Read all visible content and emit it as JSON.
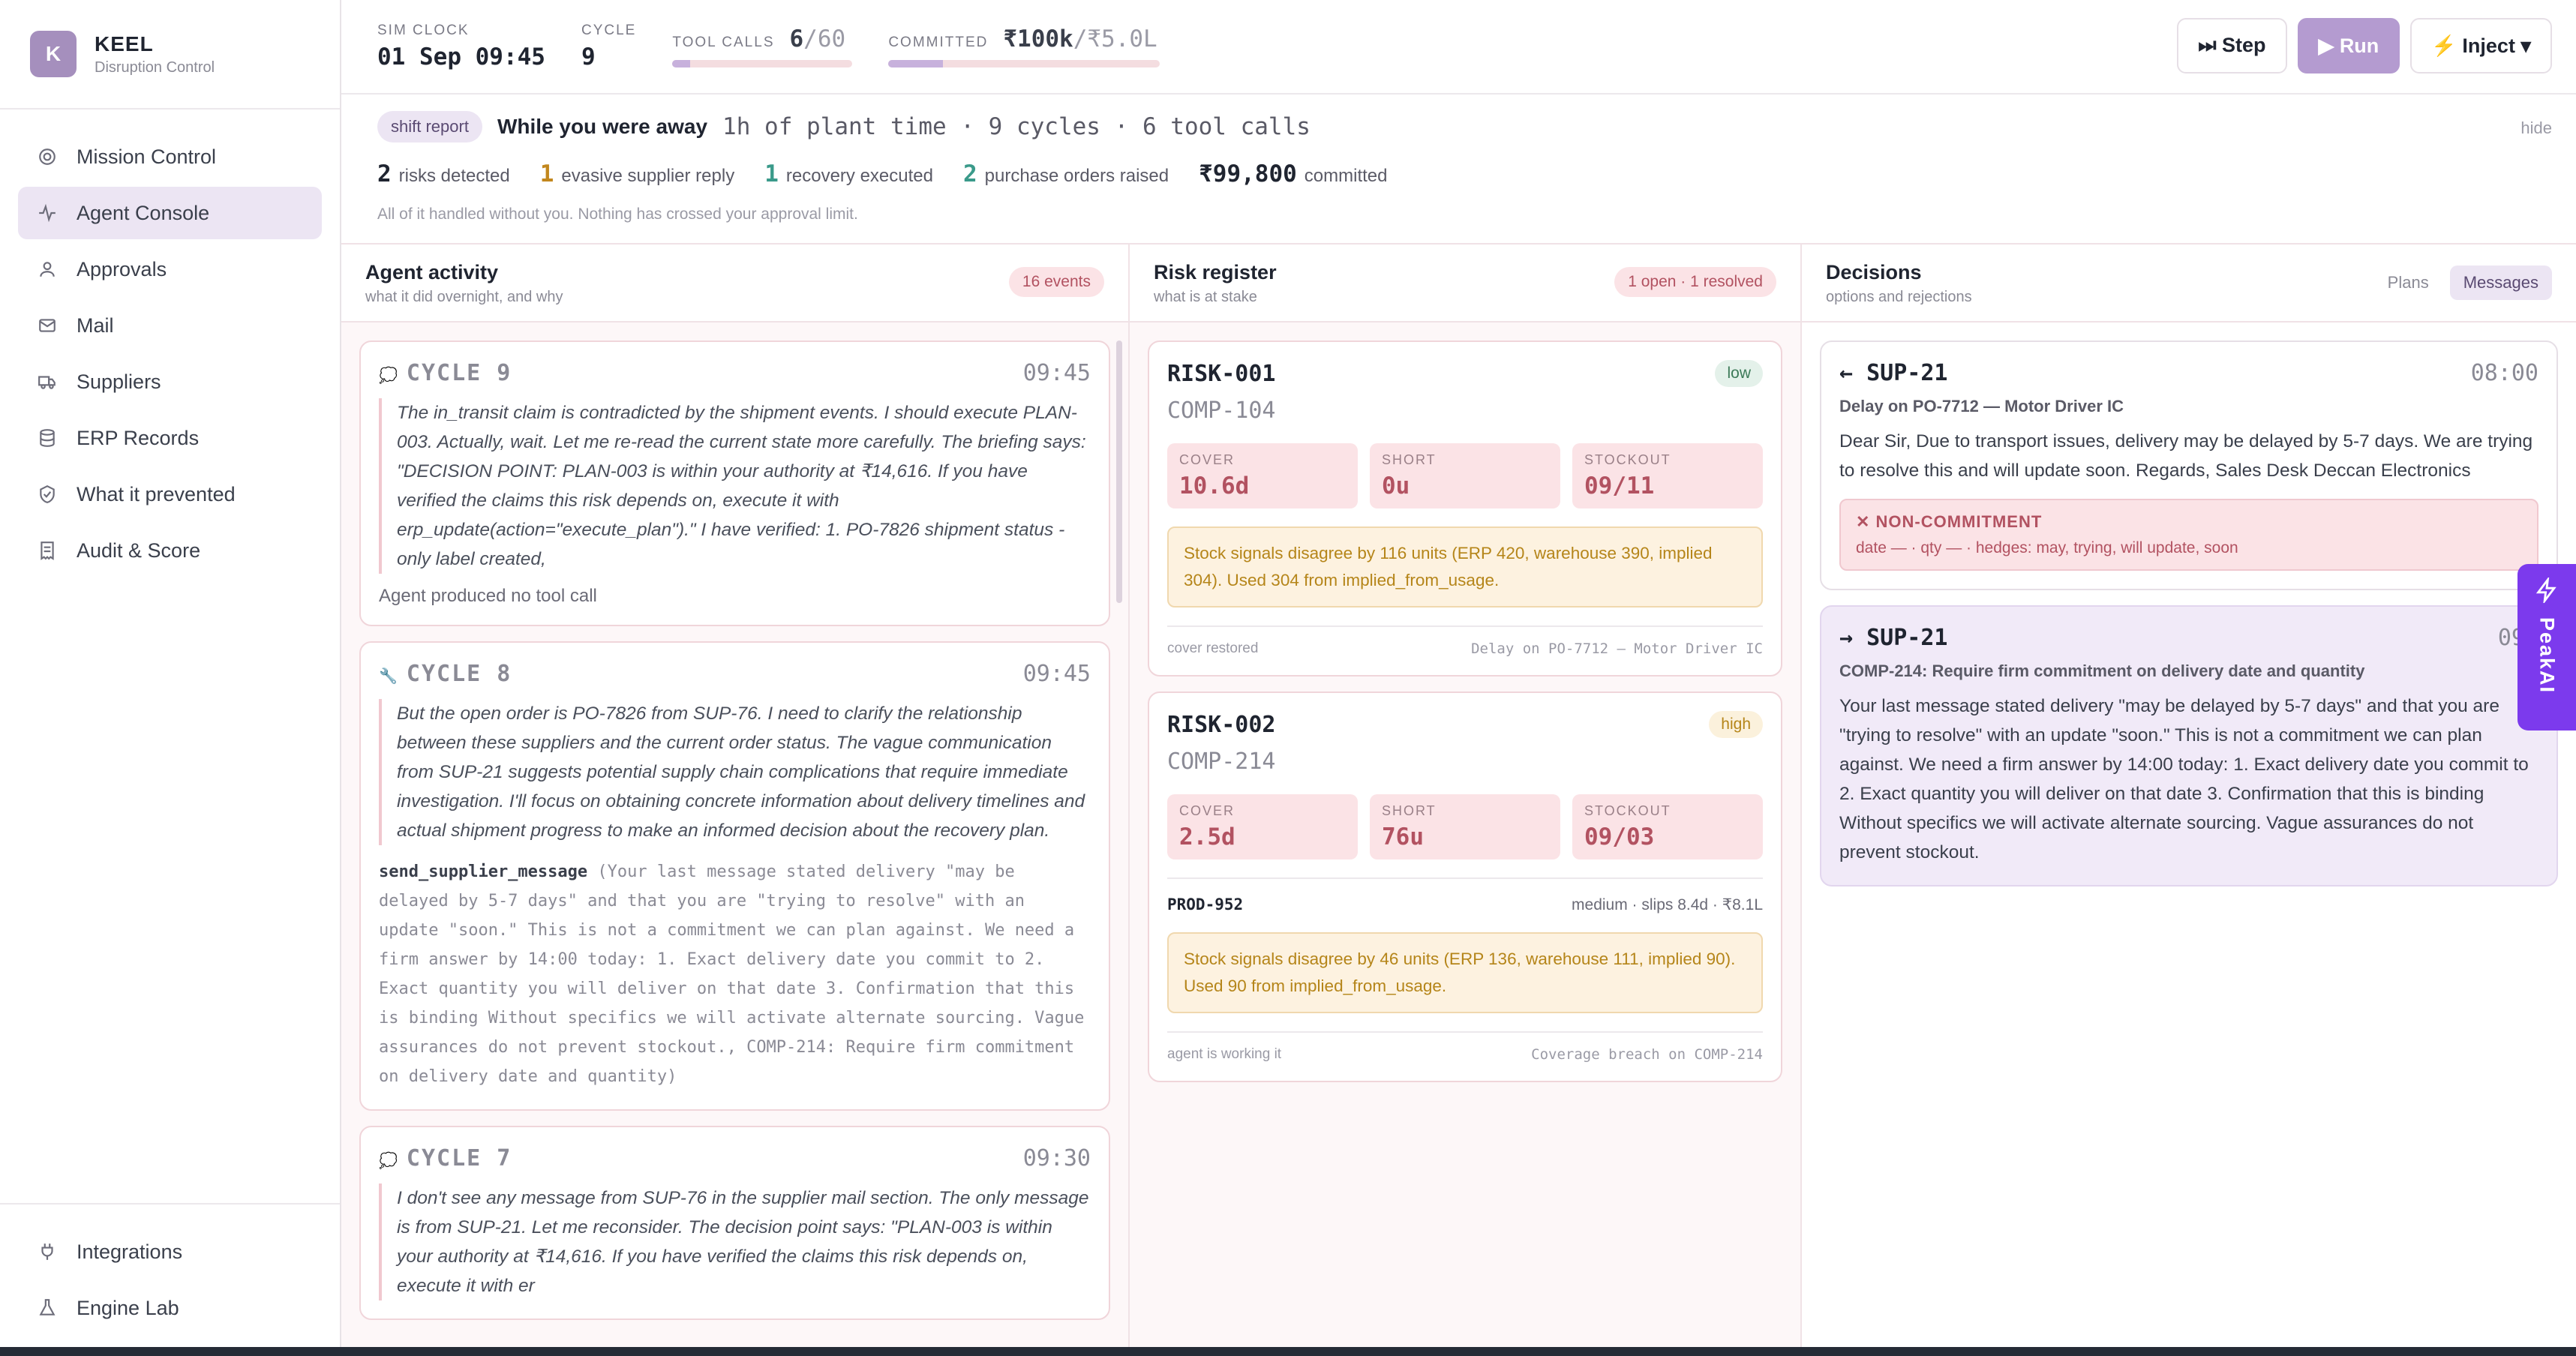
{
  "brand": {
    "initial": "K",
    "name": "KEEL",
    "subtitle": "Disruption Control"
  },
  "nav": {
    "items": [
      {
        "label": "Mission Control",
        "icon": "target-icon"
      },
      {
        "label": "Agent Console",
        "icon": "activity-icon",
        "active": true
      },
      {
        "label": "Approvals",
        "icon": "user-check-icon"
      },
      {
        "label": "Mail",
        "icon": "mail-icon"
      },
      {
        "label": "Suppliers",
        "icon": "truck-icon"
      },
      {
        "label": "ERP Records",
        "icon": "database-icon"
      },
      {
        "label": "What it prevented",
        "icon": "shield-icon"
      },
      {
        "label": "Audit & Score",
        "icon": "receipt-icon"
      }
    ],
    "bottom": [
      {
        "label": "Integrations",
        "icon": "plug-icon"
      },
      {
        "label": "Engine Lab",
        "icon": "flask-icon"
      }
    ]
  },
  "topbar": {
    "sim_clock_label": "SIM CLOCK",
    "sim_clock_value": "01 Sep 09:45",
    "cycle_label": "CYCLE",
    "cycle_value": "9",
    "tool_calls_label": "TOOL CALLS",
    "tool_calls_used": "6",
    "tool_calls_limit": "/60",
    "tool_calls_fraction": 0.1,
    "committed_label": "COMMITTED",
    "committed_value": "₹100k",
    "committed_limit": "/₹5.0L",
    "committed_fraction": 0.2,
    "step_label": "⏭ Step",
    "run_label": "▶ Run",
    "inject_label": "⚡ Inject ▾"
  },
  "shift": {
    "pill": "shift report",
    "title": "While you were away",
    "detail": "1h of plant time · 9 cycles · 6 tool calls",
    "hide": "hide",
    "stats": [
      {
        "count": "2",
        "label": "risks detected",
        "tone": "cnt"
      },
      {
        "count": "1",
        "label": "evasive supplier reply",
        "tone": "amber"
      },
      {
        "count": "1",
        "label": "recovery executed",
        "tone": "teal"
      },
      {
        "count": "2",
        "label": "purchase orders raised",
        "tone": "teal"
      },
      {
        "count": "₹99,800",
        "label": "committed",
        "tone": "cnt"
      }
    ],
    "note": "All of it handled without you. Nothing has crossed your approval limit."
  },
  "activity": {
    "title": "Agent activity",
    "subtitle": "what it did overnight, and why",
    "badge": "16 events",
    "cycles": [
      {
        "icon": "💭",
        "title": "CYCLE 9",
        "time": "09:45",
        "reasoning": "The in_transit claim is contradicted by the shipment events. I should execute PLAN-003. Actually, wait. Let me re-read the current state more carefully. The briefing says: \"DECISION POINT: PLAN-003 is within your authority at ₹14,616. If you have verified the claims this risk depends on, execute it with erp_update(action=\"execute_plan\").\" I have verified: 1. PO-7826 shipment status - only label created,",
        "note": "Agent produced no tool call"
      },
      {
        "icon": "🔧",
        "title": "CYCLE 8",
        "time": "09:45",
        "reasoning": "But the open order is PO-7826 from SUP-76. I need to clarify the relationship between these suppliers and the current order status. The vague communication from SUP-21 suggests potential supply chain complications that require immediate investigation. I'll focus on obtaining concrete information about delivery timelines and actual shipment progress to make an informed decision about the recovery plan.",
        "tool": "send_supplier_message",
        "tool_args": " (Your last message stated delivery \"may be delayed by 5-7 days\" and that you are \"trying to resolve\" with an update \"soon.\" This is not a commitment we can plan against. We need a firm answer by 14:00 today: 1. Exact delivery date you commit to 2. Exact quantity you will deliver on that date 3. Confirmation that this is binding Without specifics we will activate alternate sourcing. Vague assurances do not prevent stockout., COMP-214: Require firm commitment on delivery date and quantity)"
      },
      {
        "icon": "💭",
        "title": "CYCLE 7",
        "time": "09:30",
        "reasoning": "I don't see any message from SUP-76 in the supplier mail section. The only message is from SUP-21. Let me reconsider. The decision point says: \"PLAN-003 is within your authority at ₹14,616. If you have verified the claims this risk depends on, execute it with er"
      }
    ]
  },
  "risks": {
    "title": "Risk register",
    "subtitle": "what is at stake",
    "badge": "1 open · 1 resolved",
    "items": [
      {
        "id": "RISK-001",
        "component": "COMP-104",
        "severity": "low",
        "cover_label": "COVER",
        "cover": "10.6d",
        "short_label": "SHORT",
        "short": "0u",
        "stockout_label": "STOCKOUT",
        "stockout": "09/11",
        "warning": "Stock signals disagree by 116 units (ERP 420, warehouse 390, implied 304). Used 304 from implied_from_usage.",
        "status": "cover restored",
        "cause": "Delay on PO-7712 — Motor Driver IC"
      },
      {
        "id": "RISK-002",
        "component": "COMP-214",
        "severity": "high",
        "cover_label": "COVER",
        "cover": "2.5d",
        "short_label": "SHORT",
        "short": "76u",
        "stockout_label": "STOCKOUT",
        "stockout": "09/03",
        "product": "PROD-952",
        "product_detail": "medium · slips 8.4d · ₹8.1L",
        "warning": "Stock signals disagree by 46 units (ERP 136, warehouse 111, implied 90). Used 90 from implied_from_usage.",
        "status": "agent is working it",
        "cause": "Coverage breach on COMP-214"
      }
    ]
  },
  "decisions": {
    "title": "Decisions",
    "subtitle": "options and rejections",
    "tab_plans": "Plans",
    "tab_messages": "Messages",
    "messages": [
      {
        "direction": "←",
        "party": "SUP-21",
        "time": "08:00",
        "subject": "Delay on PO-7712 — Motor Driver IC",
        "body": "Dear Sir, Due to transport issues, delivery may be delayed by 5-7 days. We are trying to resolve this and will update soon. Regards, Sales Desk Deccan Electronics",
        "flag_title": "✕ NON-COMMITMENT",
        "flag_detail": "date — · qty — · hedges: may, trying, will update, soon"
      },
      {
        "direction": "→",
        "party": "SUP-21",
        "time": "09:",
        "subject": "COMP-214: Require firm commitment on delivery date and quantity",
        "body": "Your last message stated delivery \"may be delayed by 5-7 days\" and that you are \"trying to resolve\" with an update \"soon.\" This is not a commitment we can plan against. We need a firm answer by 14:00 today: 1. Exact delivery date you commit to 2. Exact quantity you will deliver on that date 3. Confirmation that this is binding Without specifics we will activate alternate sourcing. Vague assurances do not prevent stockout."
      }
    ]
  },
  "widget": {
    "label": "PeakAI",
    "icon": "bolt-icon"
  }
}
